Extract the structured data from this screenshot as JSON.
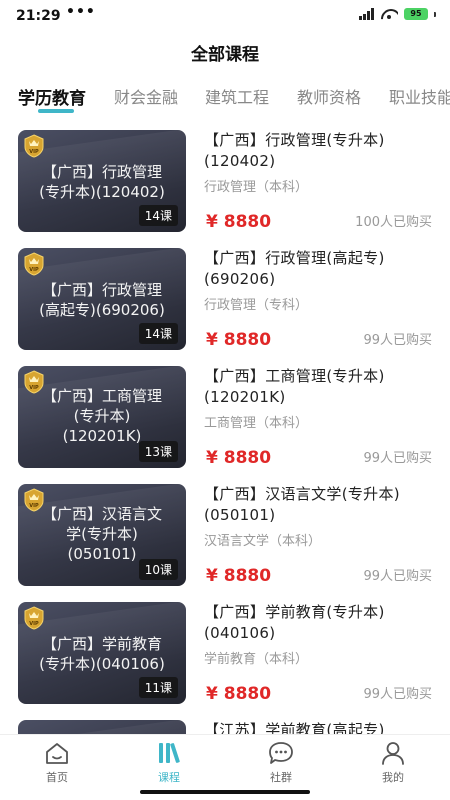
{
  "status_bar": {
    "time": "21:29",
    "dots": "•••",
    "battery": "95"
  },
  "page_title": "全部课程",
  "tabs": [
    {
      "label": "学历教育",
      "active": true
    },
    {
      "label": "财会金融",
      "active": false
    },
    {
      "label": "建筑工程",
      "active": false
    },
    {
      "label": "教师资格",
      "active": false
    },
    {
      "label": "职业技能",
      "active": false
    }
  ],
  "courses": [
    {
      "thumb_lines": [
        "【广西】行政管理",
        "(专升本)(120402)"
      ],
      "lessons": "14课",
      "title": "【广西】行政管理(专升本)(120402)",
      "subtitle": "行政管理（本科）",
      "price": "¥ 8880",
      "bought": "100人已购买"
    },
    {
      "thumb_lines": [
        "【广西】行政管理",
        "(高起专)(690206)"
      ],
      "lessons": "14课",
      "title": "【广西】行政管理(高起专)(690206)",
      "subtitle": "行政管理（专科）",
      "price": "¥ 8880",
      "bought": "99人已购买"
    },
    {
      "thumb_lines": [
        "【广西】工商管理",
        "(专升本)",
        "(120201K)"
      ],
      "lessons": "13课",
      "title": "【广西】工商管理(专升本)(120201K)",
      "subtitle": "工商管理（本科）",
      "price": "¥ 8880",
      "bought": "99人已购买"
    },
    {
      "thumb_lines": [
        "【广西】汉语言文",
        "学(专升本)",
        "(050101)"
      ],
      "lessons": "10课",
      "title": "【广西】汉语言文学(专升本)(050101)",
      "subtitle": "汉语言文学（本科）",
      "price": "¥ 8880",
      "bought": "99人已购买"
    },
    {
      "thumb_lines": [
        "【广西】学前教育",
        "(专升本)(040106)"
      ],
      "lessons": "11课",
      "title": "【广西】学前教育(专升本)(040106)",
      "subtitle": "学前教育（本科）",
      "price": "¥ 8880",
      "bought": "99人已购买"
    },
    {
      "thumb_lines": [],
      "lessons": "",
      "title": "【江苏】学前教育(高起专)",
      "subtitle": "",
      "price": "",
      "bought": ""
    }
  ],
  "bottom_nav": [
    {
      "label": "首页",
      "icon": "home-icon",
      "active": false
    },
    {
      "label": "课程",
      "icon": "courses-icon",
      "active": true
    },
    {
      "label": "社群",
      "icon": "community-icon",
      "active": false
    },
    {
      "label": "我的",
      "icon": "profile-icon",
      "active": false
    }
  ],
  "colors": {
    "accent": "#3fb6c8",
    "price": "#e02828",
    "thumb_bg": "#3a3d4e"
  }
}
